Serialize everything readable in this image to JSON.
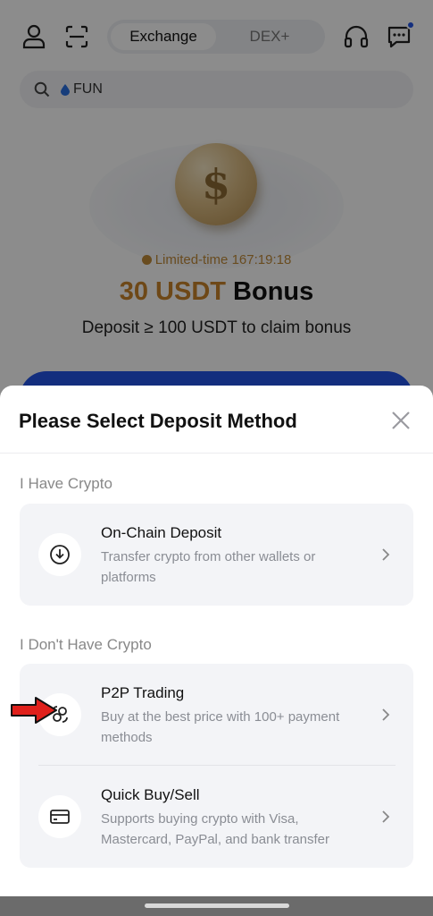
{
  "header": {
    "tabs": [
      {
        "label": "Exchange",
        "active": true
      },
      {
        "label": "DEX+",
        "active": false
      }
    ],
    "icons": {
      "profile": "user-icon",
      "scan": "scan-icon",
      "support": "headset-icon",
      "messages": "chat-icon"
    }
  },
  "search": {
    "placeholder": "FUN"
  },
  "promo": {
    "limited_label": "Limited-time",
    "countdown": "167:19:18",
    "bonus_amount": "30 USDT",
    "bonus_word": "Bonus",
    "deposit_note": "Deposit ≥ 100 USDT to claim bonus",
    "coin_symbol": "$"
  },
  "sheet": {
    "title": "Please Select Deposit Method",
    "sections": [
      {
        "label": "I Have Crypto",
        "options": [
          {
            "title": "On-Chain Deposit",
            "desc": "Transfer crypto from other wallets or platforms",
            "icon": "download-icon"
          }
        ]
      },
      {
        "label": "I Don't Have Crypto",
        "options": [
          {
            "title": "P2P Trading",
            "desc": "Buy at the best price with 100+ payment methods",
            "icon": "p2p-icon"
          },
          {
            "title": "Quick Buy/Sell",
            "desc": "Supports buying crypto with Visa, Mastercard, PayPal, and bank transfer",
            "icon": "card-icon"
          }
        ]
      }
    ]
  },
  "colors": {
    "accent": "#2354e6",
    "gold": "#c8842b",
    "annotation_arrow": "#e0201b"
  }
}
